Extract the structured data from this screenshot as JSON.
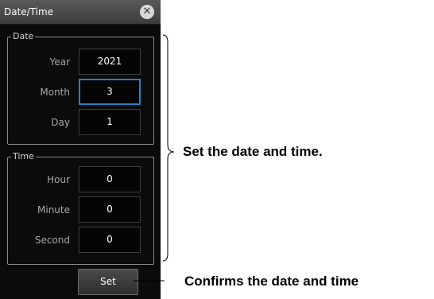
{
  "dialog": {
    "title": "Date/Time",
    "close_icon": "close-icon",
    "date_group": {
      "label": "Date",
      "fields": [
        {
          "label": "Year",
          "value": "2021"
        },
        {
          "label": "Month",
          "value": "3"
        },
        {
          "label": "Day",
          "value": "1"
        }
      ]
    },
    "time_group": {
      "label": "Time",
      "fields": [
        {
          "label": "Hour",
          "value": "0"
        },
        {
          "label": "Minute",
          "value": "0"
        },
        {
          "label": "Second",
          "value": "0"
        }
      ]
    },
    "set_label": "Set"
  },
  "annotations": {
    "fields_note": "Set the date and time.",
    "set_note": "Confirms the date and time"
  },
  "colors": {
    "dialog_bg": "#0b0b0b",
    "selected_border": "#2c7ec4"
  }
}
